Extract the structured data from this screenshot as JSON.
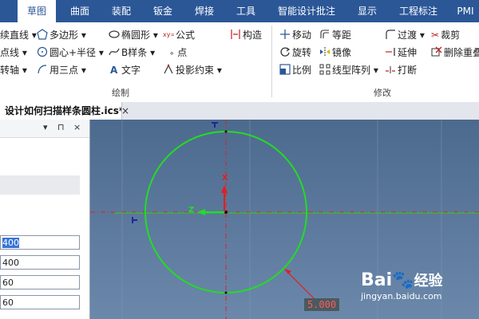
{
  "menu": {
    "items": [
      "草图",
      "曲面",
      "装配",
      "钣金",
      "焊接",
      "工具",
      "智能设计批注",
      "显示",
      "工程标注",
      "PMI"
    ],
    "active_index": 0
  },
  "ribbon": {
    "draw": {
      "col1": [
        "续直线",
        "点线",
        "转轴"
      ],
      "col2": [
        "多边形",
        "圆心+半径",
        "用三点"
      ],
      "col3": [
        "椭圆形",
        "B样条",
        "文字"
      ],
      "col4": [
        "公式",
        "点",
        "投影约束"
      ],
      "col5": [
        "构造"
      ],
      "group_label": "绘制"
    },
    "modify": {
      "col1": [
        "移动",
        "旋转",
        "比例"
      ],
      "col2": [
        "等距",
        "镜像",
        "线型阵列"
      ],
      "col3": [
        "过渡",
        "延伸",
        "打断"
      ],
      "col4": [
        "裁剪",
        "删除重叠"
      ],
      "group_label": "修改"
    }
  },
  "document": {
    "tab_title": "设计如何扫描样条圆柱.ics*",
    "close_glyph": "×"
  },
  "left_panel": {
    "header_buttons": [
      "▾",
      "⊓",
      "×"
    ],
    "fields": [
      "400",
      "400",
      "60",
      "60"
    ],
    "selected_field_index": 0
  },
  "canvas": {
    "axis_x_label": "X",
    "axis_z_label": "Z",
    "dimension_value": "5.000",
    "circle_color": "#22dd22",
    "construction_color": "#e02020",
    "background_top": "#4c6a8e",
    "background_bottom": "#6b88ab"
  },
  "watermark": {
    "brand": "Bai",
    "brand_suffix": "经验",
    "url": "jingyan.baidu.com"
  }
}
